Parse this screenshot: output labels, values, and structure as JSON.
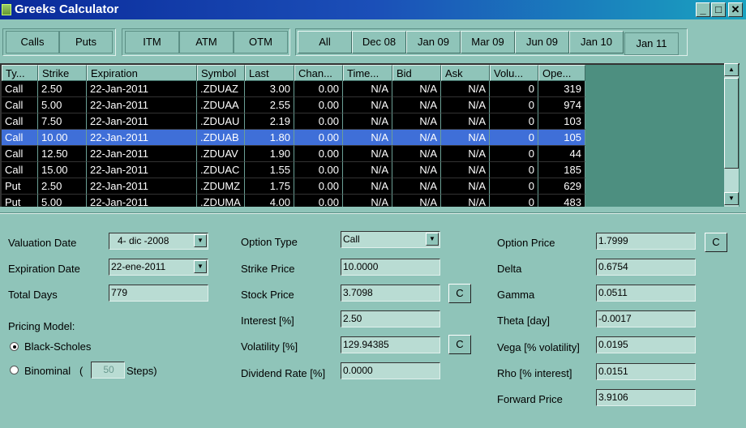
{
  "window": {
    "title": "Greeks Calculator"
  },
  "filters": {
    "type": [
      "Calls",
      "Puts"
    ],
    "moneyness": [
      "ITM",
      "ATM",
      "OTM"
    ],
    "expiry": [
      "All",
      "Dec 08",
      "Jan 09",
      "Mar 09",
      "Jun 09",
      "Jan 10",
      "Jan 11"
    ],
    "selected_expiry": "Jan 11"
  },
  "table": {
    "columns": [
      "Ty...",
      "Strike",
      "Expiration",
      "Symbol",
      "Last",
      "Chan...",
      "Time...",
      "Bid",
      "Ask",
      "Volu...",
      "Ope..."
    ],
    "rows": [
      [
        "Call",
        "2.50",
        "22-Jan-2011",
        ".ZDUAZ",
        "3.00",
        "0.00",
        "N/A",
        "N/A",
        "N/A",
        "0",
        "319"
      ],
      [
        "Call",
        "5.00",
        "22-Jan-2011",
        ".ZDUAA",
        "2.55",
        "0.00",
        "N/A",
        "N/A",
        "N/A",
        "0",
        "974"
      ],
      [
        "Call",
        "7.50",
        "22-Jan-2011",
        ".ZDUAU",
        "2.19",
        "0.00",
        "N/A",
        "N/A",
        "N/A",
        "0",
        "103"
      ],
      [
        "Call",
        "10.00",
        "22-Jan-2011",
        ".ZDUAB",
        "1.80",
        "0.00",
        "N/A",
        "N/A",
        "N/A",
        "0",
        "105"
      ],
      [
        "Call",
        "12.50",
        "22-Jan-2011",
        ".ZDUAV",
        "1.90",
        "0.00",
        "N/A",
        "N/A",
        "N/A",
        "0",
        "44"
      ],
      [
        "Call",
        "15.00",
        "22-Jan-2011",
        ".ZDUAC",
        "1.55",
        "0.00",
        "N/A",
        "N/A",
        "N/A",
        "0",
        "185"
      ],
      [
        "Put",
        "2.50",
        "22-Jan-2011",
        ".ZDUMZ",
        "1.75",
        "0.00",
        "N/A",
        "N/A",
        "N/A",
        "0",
        "629"
      ],
      [
        "Put",
        "5.00",
        "22-Jan-2011",
        ".ZDUMA",
        "4.00",
        "0.00",
        "N/A",
        "N/A",
        "N/A",
        "0",
        "483"
      ]
    ],
    "selected_row": 3
  },
  "left": {
    "valuation_date_label": "Valuation Date",
    "valuation_date": "4- dic -2008",
    "expiration_date_label": "Expiration Date",
    "expiration_date": "22-ene-2011",
    "total_days_label": "Total Days",
    "total_days": "779",
    "pricing_model_label": "Pricing Model:",
    "black_scholes": "Black-Scholes",
    "binominal": "Binominal",
    "paren": "(",
    "steps": "50",
    "steps_label": "Steps)"
  },
  "middle": {
    "option_type_label": "Option Type",
    "option_type": "Call",
    "strike_label": "Strike Price",
    "strike": "10.0000",
    "stock_label": "Stock Price",
    "stock": "3.7098",
    "interest_label": "Interest [%]",
    "interest": "2.50",
    "volatility_label": "Volatility [%]",
    "volatility": "129.94385",
    "dividend_label": "Dividend Rate [%]",
    "dividend": "0.0000",
    "c": "C"
  },
  "right": {
    "option_price_label": "Option Price",
    "option_price": "1.7999",
    "delta_label": "Delta",
    "delta": "0.6754",
    "gamma_label": "Gamma",
    "gamma": "0.0511",
    "theta_label": "Theta [day]",
    "theta": "-0.0017",
    "vega_label": "Vega [% volatility]",
    "vega": "0.0195",
    "rho_label": "Rho [% interest]",
    "rho": "0.0151",
    "forward_label": "Forward Price",
    "forward": "3.9106"
  }
}
